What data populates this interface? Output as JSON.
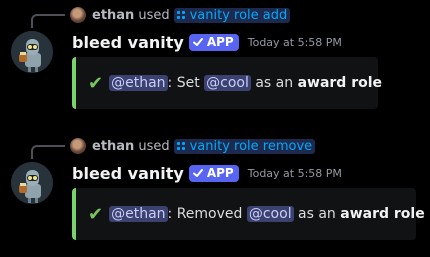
{
  "messages": [
    {
      "reply": {
        "user": "ethan",
        "used": "used",
        "command": "vanity role add"
      },
      "author": "bleed vanity",
      "badge": "APP",
      "timestamp": "Today at 5:58 PM",
      "embed": {
        "mention_user": "@ethan",
        "separator": ": ",
        "verb": "Set ",
        "mention_role": "@cool",
        "middle": " as an ",
        "emphasis": "award role"
      }
    },
    {
      "reply": {
        "user": "ethan",
        "used": "used",
        "command": "vanity role remove"
      },
      "author": "bleed vanity",
      "badge": "APP",
      "timestamp": "Today at 5:58 PM",
      "embed": {
        "mention_user": "@ethan",
        "separator": ": ",
        "verb": "Removed ",
        "mention_role": "@cool",
        "middle": " as an ",
        "emphasis": "award role"
      }
    }
  ],
  "colors": {
    "background": "#000000",
    "embed_bg": "#111214",
    "embed_accent": "#7bd36e",
    "badge": "#5865f2",
    "command_text": "#00a8fc",
    "mention_bg": "#3c4270",
    "mention_text": "#c9cdfb"
  },
  "icons": {
    "check": "check-icon",
    "command": "slash-command-icon",
    "verified": "verified-check-icon"
  }
}
